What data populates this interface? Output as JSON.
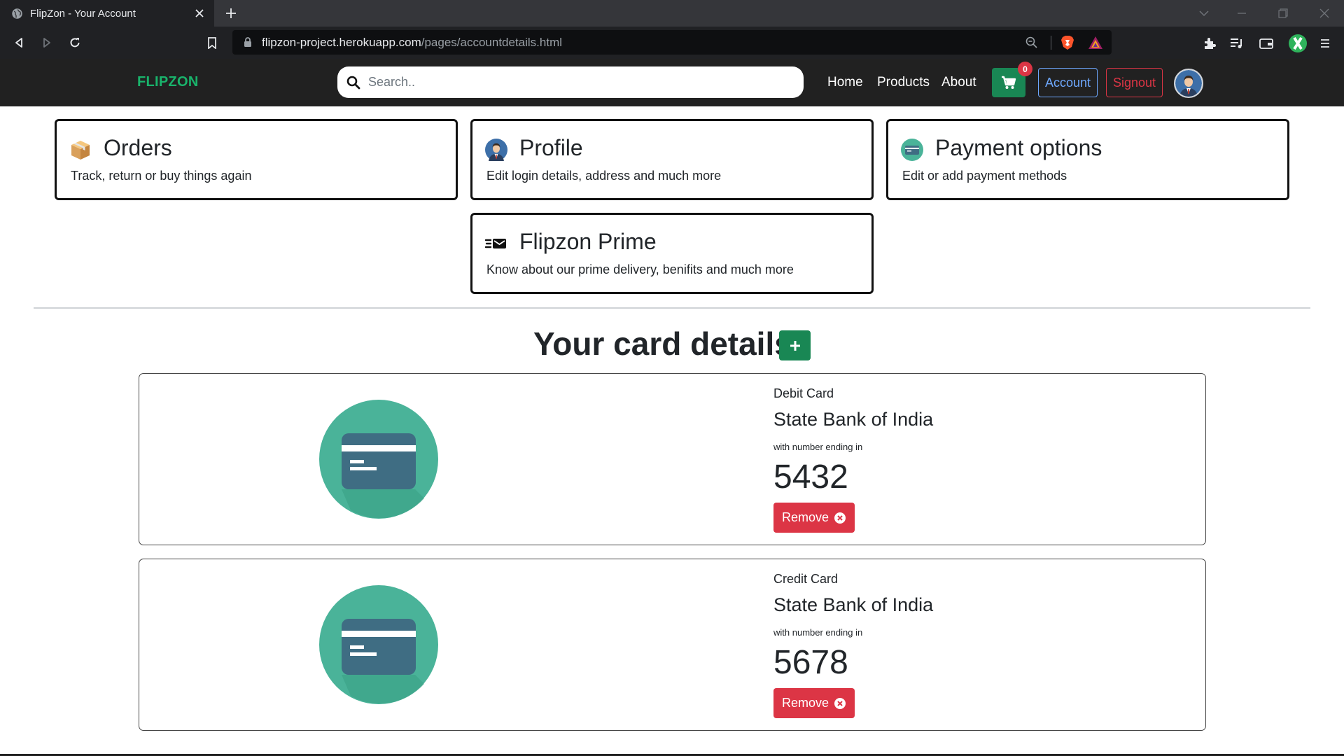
{
  "browser": {
    "tab_title": "FlipZon - Your Account",
    "url_host": "flipzon-project.herokuapp.com",
    "url_path": "/pages/accountdetails.html"
  },
  "nav": {
    "brand": "FLIPZON",
    "search_placeholder": "Search..",
    "links": [
      "Home",
      "Products",
      "About"
    ],
    "cart_count": "0",
    "account_label": "Account",
    "signout_label": "Signout",
    "colors": {
      "brand": "#19b36b",
      "cart": "#198754",
      "account": "#6ea8fe",
      "signout": "#dc3545",
      "navbar_bg": "#212121"
    }
  },
  "options": [
    {
      "icon": "package-icon",
      "title": "Orders",
      "desc": "Track, return or buy things again"
    },
    {
      "icon": "user-avatar-icon",
      "title": "Profile",
      "desc": "Edit login details, address and much more"
    },
    {
      "icon": "payment-card-icon",
      "title": "Payment options",
      "desc": "Edit or add payment methods"
    },
    {
      "icon": "fast-mail-icon",
      "title": "Flipzon Prime",
      "desc": "Know about our prime delivery, benifits and much more"
    }
  ],
  "cards_section": {
    "heading": "Your card details",
    "add_icon": "plus-icon",
    "note_label": "with number ending in",
    "remove_label": "Remove",
    "cards": [
      {
        "type": "Debit Card",
        "bank": "State Bank of India",
        "last4": "5432"
      },
      {
        "type": "Credit Card",
        "bank": "State Bank of India",
        "last4": "5678"
      }
    ]
  }
}
